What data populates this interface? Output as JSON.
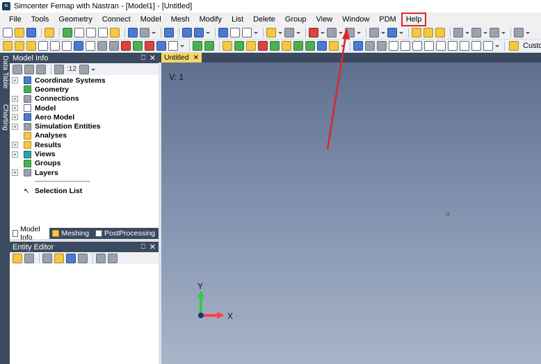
{
  "window": {
    "title": "Simcenter Femap with Nastran - [Model1] - [Untitled]"
  },
  "menu": {
    "items": [
      "File",
      "Tools",
      "Geometry",
      "Connect",
      "Model",
      "Mesh",
      "Modify",
      "List",
      "Delete",
      "Group",
      "View",
      "Window",
      "PDM",
      "Help"
    ],
    "highlighted": "Help"
  },
  "toolbar": {
    "custom_label": "Custom"
  },
  "side_tabs": [
    "Data Table",
    "Charting"
  ],
  "model_info": {
    "title": "Model Info",
    "pin": "⎕",
    "close": "✕",
    "level_text": ":12",
    "tree": [
      {
        "label": "Coordinate Systems",
        "icon": "coordinate-systems-icon",
        "expandable": true
      },
      {
        "label": "Geometry",
        "icon": "geometry-icon",
        "expandable": false
      },
      {
        "label": "Connections",
        "icon": "connections-icon",
        "expandable": true
      },
      {
        "label": "Model",
        "icon": "model-icon",
        "expandable": true
      },
      {
        "label": "Aero Model",
        "icon": "aero-model-icon",
        "expandable": true
      },
      {
        "label": "Simulation Entities",
        "icon": "simulation-entities-icon",
        "expandable": true
      },
      {
        "label": "Analyses",
        "icon": "analyses-icon",
        "expandable": false
      },
      {
        "label": "Results",
        "icon": "results-icon",
        "expandable": true
      },
      {
        "label": "Views",
        "icon": "views-icon",
        "expandable": true
      },
      {
        "label": "Groups",
        "icon": "groups-icon",
        "expandable": false
      },
      {
        "label": "Layers",
        "icon": "layers-icon",
        "expandable": true
      }
    ],
    "separator": "----------------------------",
    "selection_list": "Selection List",
    "tabs": [
      "Model Info",
      "Meshing",
      "PostProcessing"
    ]
  },
  "entity_editor": {
    "title": "Entity Editor",
    "pin": "⎕",
    "close": "✕"
  },
  "view": {
    "tab_label": "Untitled",
    "tab_close": "✕",
    "view_label": "V: 1",
    "axis_y": "Y",
    "axis_x": "X"
  },
  "colors": {
    "annotation": "#e0242a",
    "panel_header": "#3b4a5e",
    "view_tab": "#f6d66b"
  }
}
